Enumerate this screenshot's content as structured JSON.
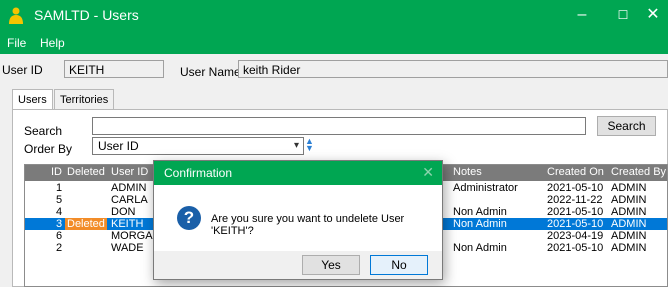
{
  "window": {
    "title": "SAMLTD - Users",
    "controls": {
      "minimize": "–",
      "maximize": "☐",
      "close": "✕"
    }
  },
  "menu": [
    "File",
    "Help"
  ],
  "header": {
    "user_id_label": "User ID",
    "user_id_value": "KEITH",
    "user_name_label": "User Name",
    "user_name_value": "keith Rider"
  },
  "tabs": [
    {
      "label": "Users",
      "active": true
    },
    {
      "label": "Territories",
      "active": false
    }
  ],
  "search": {
    "label": "Search",
    "value": "",
    "button": "Search"
  },
  "order_by": {
    "label": "Order By",
    "value": "User ID"
  },
  "grid": {
    "columns": [
      "ID",
      "Deleted",
      "User ID",
      "Notes",
      "Created On",
      "Created By"
    ],
    "rows": [
      {
        "id": "1",
        "deleted": "",
        "user_id": "ADMIN",
        "notes": "Administrator",
        "created_on": "2021-05-10",
        "created_by": "ADMIN",
        "selected": false
      },
      {
        "id": "5",
        "deleted": "",
        "user_id": "CARLA",
        "notes": "",
        "created_on": "2022-11-22",
        "created_by": "ADMIN",
        "selected": false
      },
      {
        "id": "4",
        "deleted": "",
        "user_id": "DON",
        "notes": "Non Admin",
        "created_on": "2021-05-10",
        "created_by": "ADMIN",
        "selected": false
      },
      {
        "id": "3",
        "deleted": "Deleted",
        "user_id": "KEITH",
        "notes": "Non Admin",
        "created_on": "2021-05-10",
        "created_by": "ADMIN",
        "selected": true
      },
      {
        "id": "6",
        "deleted": "",
        "user_id": "MORGAN",
        "notes": "",
        "created_on": "2023-04-19",
        "created_by": "ADMIN",
        "selected": false
      },
      {
        "id": "2",
        "deleted": "",
        "user_id": "WADE",
        "notes": "Non Admin",
        "created_on": "2021-05-10",
        "created_by": "ADMIN",
        "selected": false
      }
    ]
  },
  "dialog": {
    "title": "Confirmation",
    "close": "✕",
    "icon": "question-icon",
    "icon_glyph": "?",
    "message": "Are you sure you want to undelete User 'KEITH'?",
    "yes": "Yes",
    "no": "No"
  },
  "colors": {
    "title_bar": "#00a652",
    "grid_header": "#7b7b7b",
    "selection": "#0078d7",
    "deleted_badge": "#f28c28"
  }
}
